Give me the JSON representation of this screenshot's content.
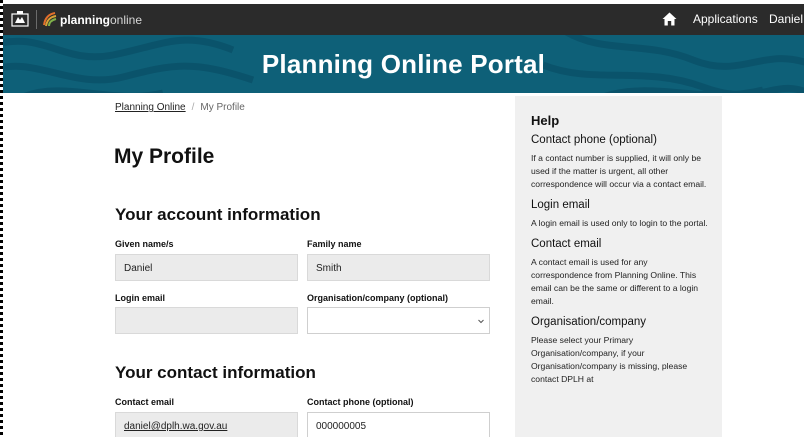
{
  "topbar": {
    "brand_bold": "planning",
    "brand_light": "online",
    "nav_applications": "Applications",
    "nav_user": "Daniel"
  },
  "hero": {
    "title": "Planning Online Portal"
  },
  "breadcrumb": {
    "home": "Planning Online",
    "separator": "/",
    "current": "My Profile"
  },
  "page_title": "My Profile",
  "account": {
    "title": "Your account information",
    "given_label": "Given name/s",
    "given_value": "Daniel",
    "family_label": "Family name",
    "family_value": "Smith",
    "login_label": "Login email",
    "login_value": "",
    "org_label": "Organisation/company (optional)",
    "org_value": ""
  },
  "contact": {
    "title": "Your contact information",
    "email_label": "Contact email",
    "email_value": "daniel@dplh.wa.gov.au",
    "phone_label": "Contact phone (optional)",
    "phone_value": "000000005"
  },
  "help": {
    "title": "Help",
    "sections": [
      {
        "heading": "Contact phone (optional)",
        "body": "If a contact number is supplied, it will only be used if the matter is urgent, all other correspondence will occur via a contact email."
      },
      {
        "heading": "Login email",
        "body": "A login email is used only to login to the portal."
      },
      {
        "heading": "Contact email",
        "body": "A contact email is used for any correspondence from Planning Online. This email can be the same or different to a login email."
      },
      {
        "heading": "Organisation/company",
        "body": "Please select your Primary Organisation/company, if your Organisation/company is missing, please contact DPLH at"
      }
    ]
  },
  "icons": {
    "crest": "wa-crest-icon",
    "brand": "planning-online-logo-icon",
    "home": "home-icon",
    "chevron": "chevron-down-icon"
  },
  "colors": {
    "topbar": "#2b2b2b",
    "hero": "#0e6078",
    "help_bg": "#f0f0f0",
    "readonly_field": "#ebebeb"
  }
}
